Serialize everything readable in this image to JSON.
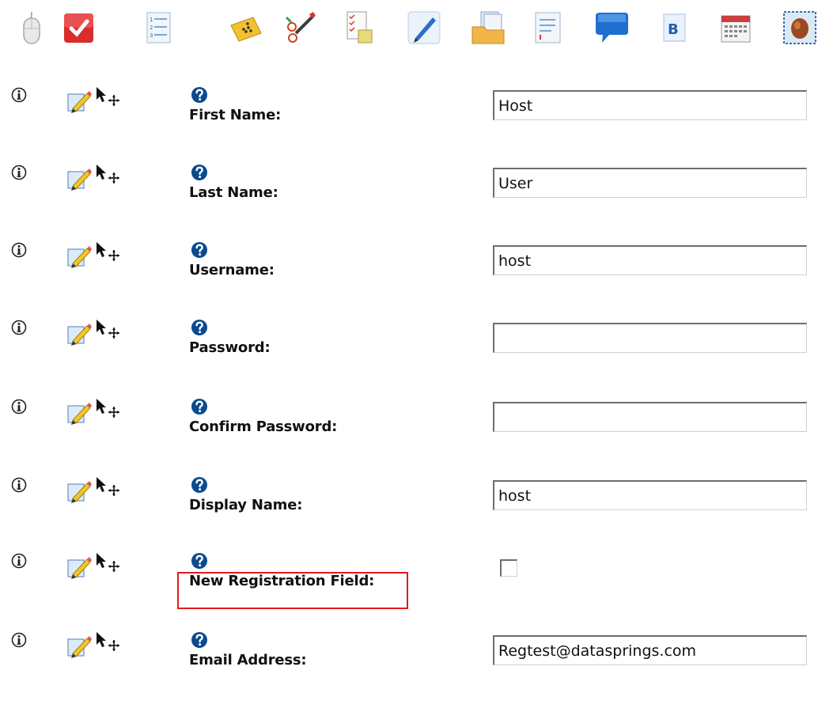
{
  "toolbar": {
    "icons": [
      "mouse-icon",
      "checkbox-icon",
      "numbered-list-icon",
      "tag-icon",
      "scissors-pen-icon",
      "checklist-doc-icon",
      "pen-icon",
      "folder-doc-icon",
      "doc-lines-icon",
      "speech-bubble-icon",
      "bold-doc-icon",
      "calendar-icon",
      "stamp-icon"
    ]
  },
  "form": {
    "fields": [
      {
        "label": "First Name:",
        "type": "text",
        "value": "Host"
      },
      {
        "label": "Last Name:",
        "type": "text",
        "value": "User"
      },
      {
        "label": "Username:",
        "type": "text",
        "value": "host"
      },
      {
        "label": "Password:",
        "type": "text",
        "value": ""
      },
      {
        "label": "Confirm Password:",
        "type": "text",
        "value": ""
      },
      {
        "label": "Display Name:",
        "type": "text",
        "value": "host"
      },
      {
        "label": "New Registration Field:",
        "type": "checkbox",
        "checked": false,
        "highlighted": true
      },
      {
        "label": "Email Address:",
        "type": "text",
        "value": "Regtest@datasprings.com"
      }
    ]
  },
  "colors": {
    "highlight": "#e41b1b",
    "help_icon": "#0b4a8f"
  }
}
